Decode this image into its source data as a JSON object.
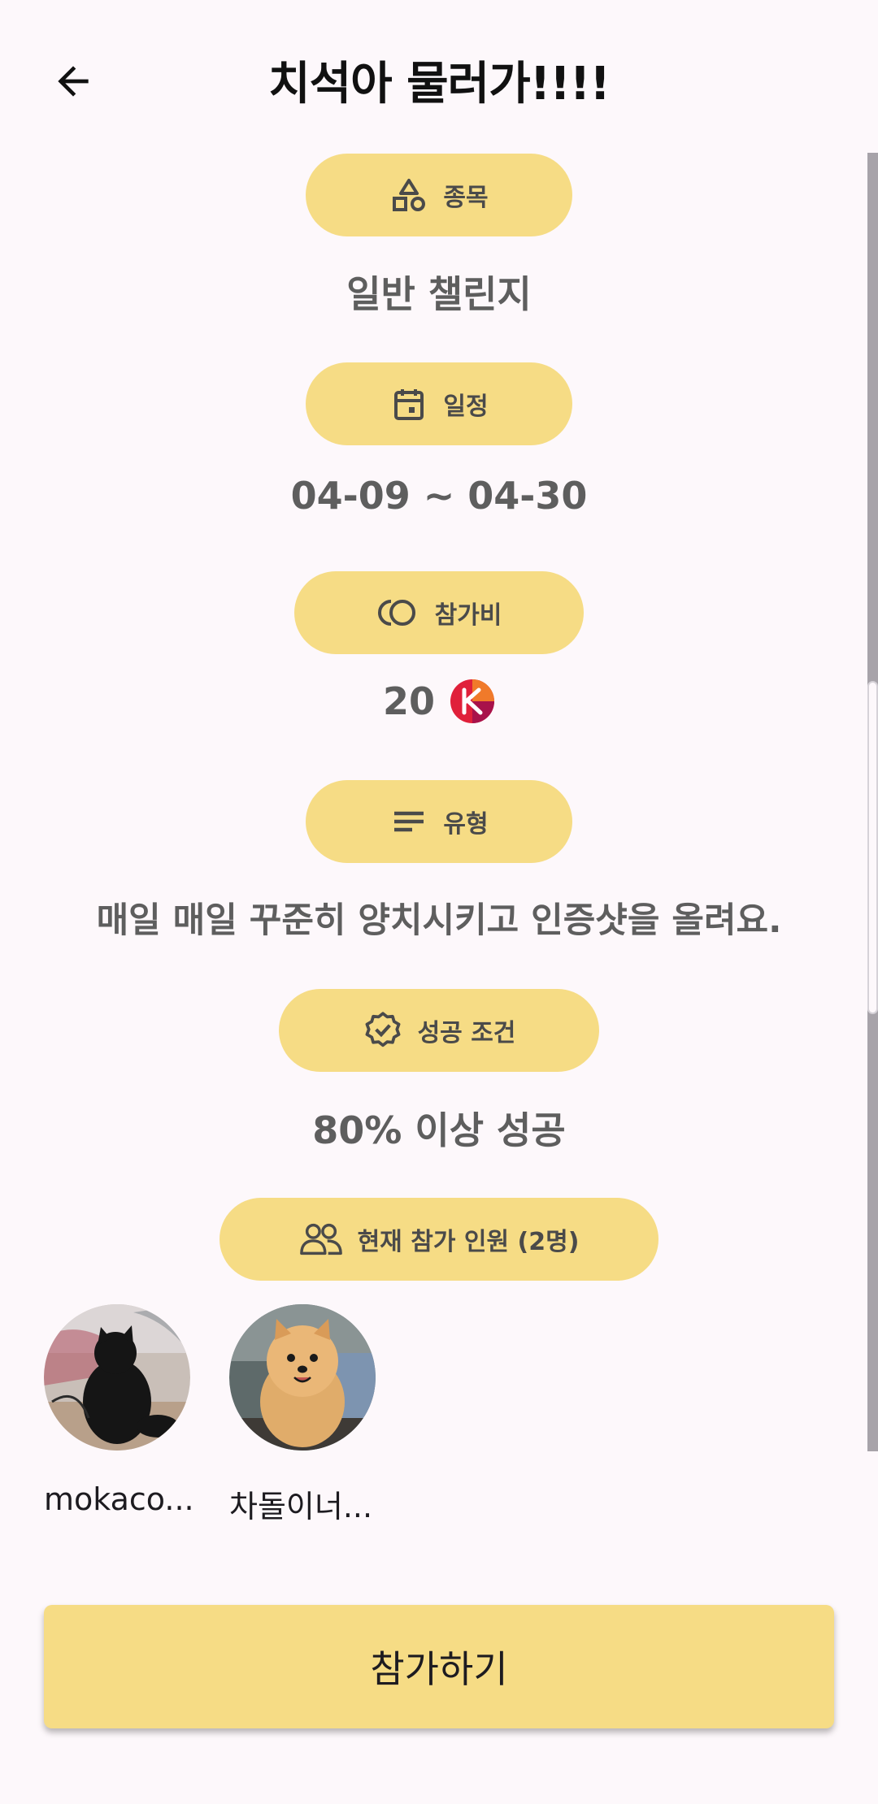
{
  "header": {
    "title": "치석아 물러가!!!!",
    "back_icon": "arrow-left-icon"
  },
  "sections": {
    "category": {
      "label": "종목",
      "icon": "shapes-icon",
      "value": "일반 챌린지"
    },
    "schedule": {
      "label": "일정",
      "icon": "calendar-icon",
      "value": "04-09 ~ 04-30"
    },
    "fee": {
      "label": "참가비",
      "icon": "coins-icon",
      "value": "20",
      "currency_icon": "k-coin-icon"
    },
    "type": {
      "label": "유형",
      "icon": "notes-icon",
      "value": "매일 매일 꾸준히 양치시키고 인증샷을 올려요."
    },
    "success": {
      "label": "성공 조건",
      "icon": "verified-badge-icon",
      "value": "80% 이상 성공"
    },
    "participants": {
      "label": "현재 참가 인원 (2명)",
      "icon": "group-icon"
    }
  },
  "participants": [
    {
      "name": "mokaco...",
      "avatar": "black-cat-photo"
    },
    {
      "name": "차돌이너...",
      "avatar": "pomeranian-photo"
    }
  ],
  "actions": {
    "join_label": "참가하기"
  },
  "colors": {
    "chip": "#f6dc85",
    "background": "#fdf8fb",
    "value_text": "#5e5e5e",
    "coin_red": "#e0203a"
  }
}
